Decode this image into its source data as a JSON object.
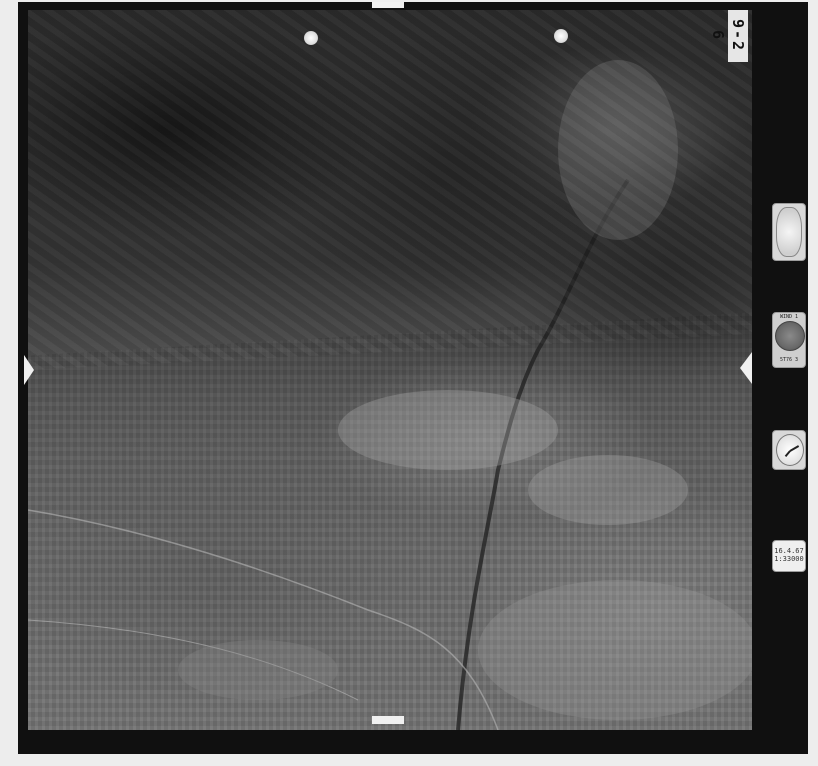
{
  "photo": {
    "frame_number": "9-2 6",
    "date_card_line1": "16.4.67",
    "date_card_line2": "1:33000",
    "level_top": "WIND 1",
    "level_bottom": "5T76 3"
  },
  "icons": {
    "altimeter": "altimeter-dial-icon",
    "level": "bubble-level-icon",
    "clock": "clock-icon",
    "fiducial": "fiducial-mark-icon"
  },
  "colors": {
    "film_frame": "#101010",
    "paper": "#ededed"
  }
}
